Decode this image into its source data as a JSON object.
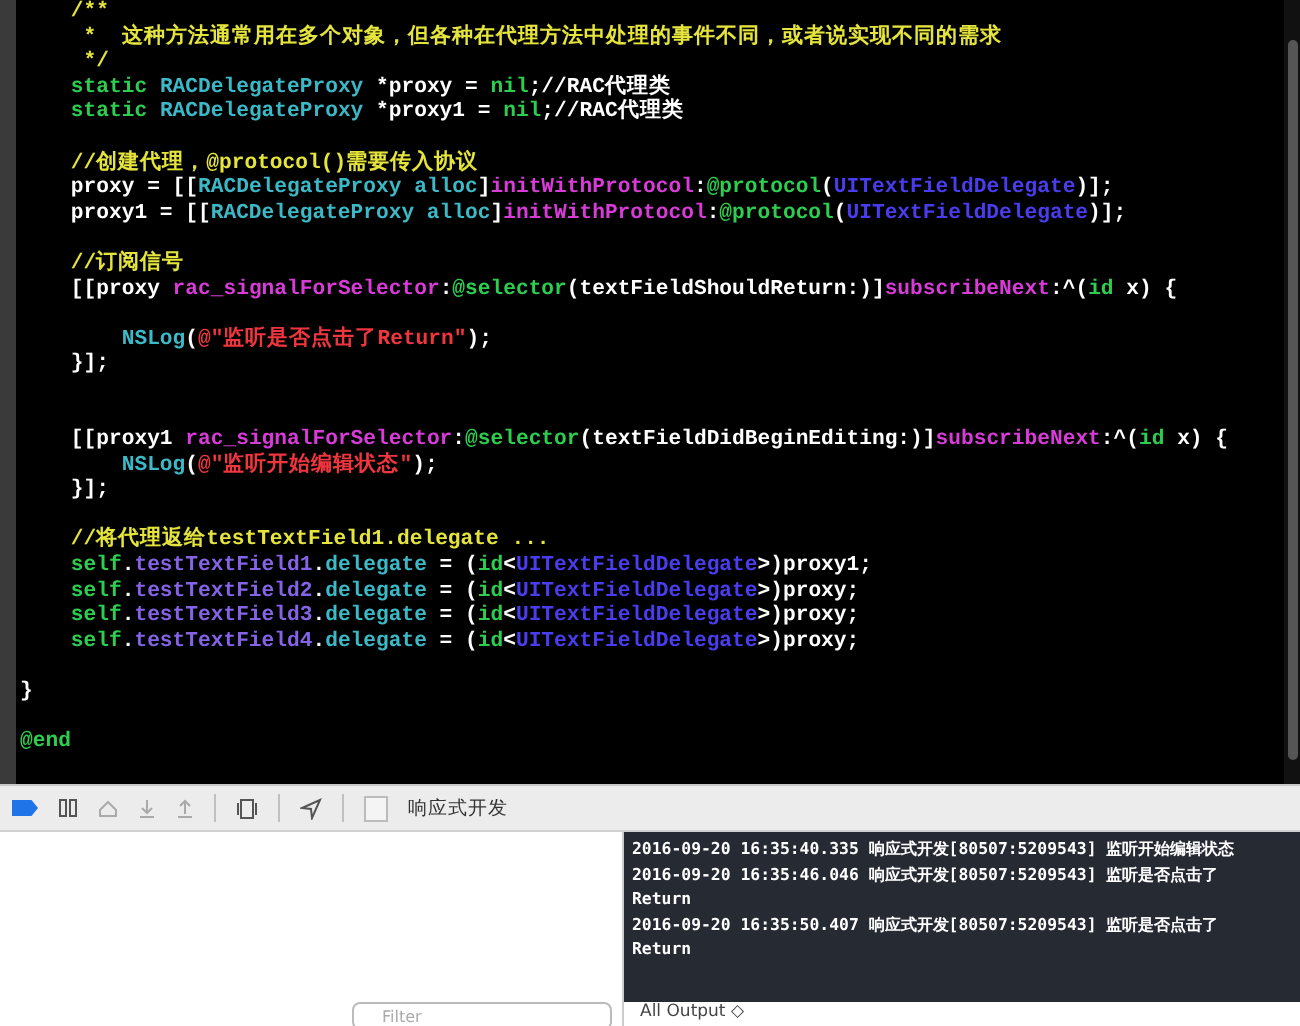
{
  "editor": {
    "lines": [
      {
        "tokens": [
          {
            "kind": "comment",
            "t": "    /**"
          }
        ]
      },
      {
        "tokens": [
          {
            "kind": "comment",
            "t": "     *  这种方法通常用在多个对象，但各种在代理方法中处理的事件不同，或者说实现不同的需求"
          }
        ]
      },
      {
        "tokens": [
          {
            "kind": "comment",
            "t": "     */"
          }
        ]
      },
      {
        "tokens": [
          {
            "kind": "keyword",
            "t": "    static "
          },
          {
            "kind": "type",
            "t": "RACDelegateProxy"
          },
          {
            "kind": "plain",
            "t": " *proxy = "
          },
          {
            "kind": "keyword",
            "t": "nil"
          },
          {
            "kind": "plain",
            "t": ";//RAC代理类"
          }
        ]
      },
      {
        "tokens": [
          {
            "kind": "keyword",
            "t": "    static "
          },
          {
            "kind": "type",
            "t": "RACDelegateProxy"
          },
          {
            "kind": "plain",
            "t": " *proxy1 = "
          },
          {
            "kind": "keyword",
            "t": "nil"
          },
          {
            "kind": "plain",
            "t": ";//RAC代理类"
          }
        ]
      },
      {
        "blank_before": true,
        "tokens": [
          {
            "kind": "comment",
            "t": "    //创建代理，@protocol()需要传入协议"
          }
        ]
      },
      {
        "tokens": [
          {
            "kind": "plain",
            "t": "    proxy = [["
          },
          {
            "kind": "type",
            "t": "RACDelegateProxy alloc"
          },
          {
            "kind": "plain",
            "t": "]"
          },
          {
            "kind": "method",
            "t": "initWithProtocol"
          },
          {
            "kind": "plain",
            "t": ":"
          },
          {
            "kind": "keyword",
            "t": "@protocol"
          },
          {
            "kind": "plain",
            "t": "("
          },
          {
            "kind": "protocol",
            "t": "UITextFieldDelegate"
          },
          {
            "kind": "plain",
            "t": ")];"
          }
        ]
      },
      {
        "tokens": [
          {
            "kind": "plain",
            "t": "    proxy1 = [["
          },
          {
            "kind": "type",
            "t": "RACDelegateProxy alloc"
          },
          {
            "kind": "plain",
            "t": "]"
          },
          {
            "kind": "method",
            "t": "initWithProtocol"
          },
          {
            "kind": "plain",
            "t": ":"
          },
          {
            "kind": "keyword",
            "t": "@protocol"
          },
          {
            "kind": "plain",
            "t": "("
          },
          {
            "kind": "protocol",
            "t": "UITextFieldDelegate"
          },
          {
            "kind": "plain",
            "t": ")];"
          }
        ]
      },
      {
        "blank_before": true,
        "tokens": [
          {
            "kind": "comment",
            "t": "    //订阅信号"
          }
        ]
      },
      {
        "tokens": [
          {
            "kind": "plain",
            "t": "    [[proxy "
          },
          {
            "kind": "method",
            "t": "rac_signalForSelector"
          },
          {
            "kind": "plain",
            "t": ":"
          },
          {
            "kind": "keyword",
            "t": "@selector"
          },
          {
            "kind": "plain",
            "t": "(textFieldShouldReturn:)]"
          },
          {
            "kind": "method",
            "t": "subscribeNext"
          },
          {
            "kind": "plain",
            "t": ":^("
          },
          {
            "kind": "keyword",
            "t": "id"
          },
          {
            "kind": "plain",
            "t": " x) {"
          }
        ]
      },
      {
        "blank_before": true,
        "tokens": [
          {
            "kind": "type",
            "t": "        NSLog"
          },
          {
            "kind": "plain",
            "t": "("
          },
          {
            "kind": "string",
            "t": "@\"监听是否点击了Return\""
          },
          {
            "kind": "plain",
            "t": ");"
          }
        ]
      },
      {
        "tokens": [
          {
            "kind": "plain",
            "t": "    }];"
          }
        ]
      },
      {
        "blank_before": true,
        "double_blank": true,
        "tokens": [
          {
            "kind": "plain",
            "t": "    [[proxy1 "
          },
          {
            "kind": "method",
            "t": "rac_signalForSelector"
          },
          {
            "kind": "plain",
            "t": ":"
          },
          {
            "kind": "keyword",
            "t": "@selector"
          },
          {
            "kind": "plain",
            "t": "(textFieldDidBeginEditing:)]"
          },
          {
            "kind": "method",
            "t": "subscribeNext"
          },
          {
            "kind": "plain",
            "t": ":^("
          },
          {
            "kind": "keyword",
            "t": "id"
          },
          {
            "kind": "plain",
            "t": " x) {"
          }
        ]
      },
      {
        "tokens": [
          {
            "kind": "type",
            "t": "        NSLog"
          },
          {
            "kind": "plain",
            "t": "("
          },
          {
            "kind": "string",
            "t": "@\"监听开始编辑状态\""
          },
          {
            "kind": "plain",
            "t": ");"
          }
        ]
      },
      {
        "tokens": [
          {
            "kind": "plain",
            "t": "    }];"
          }
        ]
      },
      {
        "blank_before": true,
        "tokens": [
          {
            "kind": "comment",
            "t": "    //将代理返给testTextField1.delegate ..."
          }
        ]
      },
      {
        "tokens": [
          {
            "kind": "keyword",
            "t": "    self"
          },
          {
            "kind": "plain",
            "t": "."
          },
          {
            "kind": "property",
            "t": "testTextField1"
          },
          {
            "kind": "plain",
            "t": "."
          },
          {
            "kind": "type",
            "t": "delegate"
          },
          {
            "kind": "plain",
            "t": " = ("
          },
          {
            "kind": "keyword",
            "t": "id"
          },
          {
            "kind": "plain",
            "t": "<"
          },
          {
            "kind": "protocol",
            "t": "UITextFieldDelegate"
          },
          {
            "kind": "plain",
            "t": ">)proxy1;"
          }
        ]
      },
      {
        "tokens": [
          {
            "kind": "keyword",
            "t": "    self"
          },
          {
            "kind": "plain",
            "t": "."
          },
          {
            "kind": "property",
            "t": "testTextField2"
          },
          {
            "kind": "plain",
            "t": "."
          },
          {
            "kind": "type",
            "t": "delegate"
          },
          {
            "kind": "plain",
            "t": " = ("
          },
          {
            "kind": "keyword",
            "t": "id"
          },
          {
            "kind": "plain",
            "t": "<"
          },
          {
            "kind": "protocol",
            "t": "UITextFieldDelegate"
          },
          {
            "kind": "plain",
            "t": ">)proxy;"
          }
        ]
      },
      {
        "tokens": [
          {
            "kind": "keyword",
            "t": "    self"
          },
          {
            "kind": "plain",
            "t": "."
          },
          {
            "kind": "property",
            "t": "testTextField3"
          },
          {
            "kind": "plain",
            "t": "."
          },
          {
            "kind": "type",
            "t": "delegate"
          },
          {
            "kind": "plain",
            "t": " = ("
          },
          {
            "kind": "keyword",
            "t": "id"
          },
          {
            "kind": "plain",
            "t": "<"
          },
          {
            "kind": "protocol",
            "t": "UITextFieldDelegate"
          },
          {
            "kind": "plain",
            "t": ">)proxy;"
          }
        ]
      },
      {
        "tokens": [
          {
            "kind": "keyword",
            "t": "    self"
          },
          {
            "kind": "plain",
            "t": "."
          },
          {
            "kind": "property",
            "t": "testTextField4"
          },
          {
            "kind": "plain",
            "t": "."
          },
          {
            "kind": "type",
            "t": "delegate"
          },
          {
            "kind": "plain",
            "t": " = ("
          },
          {
            "kind": "keyword",
            "t": "id"
          },
          {
            "kind": "plain",
            "t": "<"
          },
          {
            "kind": "protocol",
            "t": "UITextFieldDelegate"
          },
          {
            "kind": "plain",
            "t": ">)proxy;"
          }
        ]
      },
      {
        "blank_before": true,
        "tokens": [
          {
            "kind": "plain",
            "t": "}"
          }
        ]
      },
      {
        "blank_before": true,
        "tokens": [
          {
            "kind": "keyword",
            "t": "@end"
          }
        ]
      }
    ]
  },
  "debug_bar": {
    "breakpoints_on": true,
    "target": "响应式开发"
  },
  "console": {
    "lines": [
      "2016-09-20 16:35:40.335 响应式开发[80507:5209543] 监听开始编辑状态",
      "2016-09-20 16:35:46.046 响应式开发[80507:5209543] 监听是否点击了Return",
      "2016-09-20 16:35:50.407 响应式开发[80507:5209543] 监听是否点击了Return"
    ]
  },
  "bottom": {
    "filter_placeholder": "Filter",
    "output_menu": "All Output ◇"
  }
}
